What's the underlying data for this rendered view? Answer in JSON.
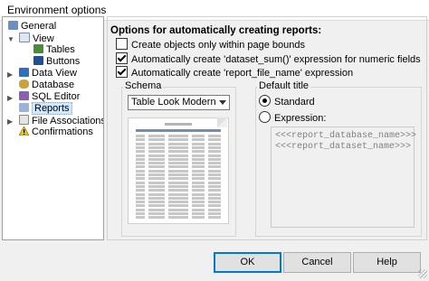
{
  "window": {
    "title": "Environment options"
  },
  "tree": {
    "items": [
      {
        "label": "General",
        "icon": "general-icon"
      },
      {
        "label": "View",
        "icon": "view-icon"
      },
      {
        "label": "Tables",
        "icon": "tables-icon"
      },
      {
        "label": "Buttons",
        "icon": "buttons-icon"
      },
      {
        "label": "Data View",
        "icon": "data-view-icon"
      },
      {
        "label": "Database",
        "icon": "database-icon"
      },
      {
        "label": "SQL Editor",
        "icon": "sql-editor-icon"
      },
      {
        "label": "Reports",
        "icon": "reports-icon"
      },
      {
        "label": "File Associations",
        "icon": "file-associations-icon"
      },
      {
        "label": "Confirmations",
        "icon": "confirmations-icon"
      }
    ],
    "selected": "Reports"
  },
  "options": {
    "heading": "Options for automatically creating reports:",
    "checkboxes": [
      {
        "label": "Create objects only within page bounds",
        "checked": false
      },
      {
        "label": "Automatically create 'dataset_sum()' expression for numeric fields",
        "checked": true
      },
      {
        "label": "Automatically create 'report_file_name' expression",
        "checked": true
      }
    ]
  },
  "schema": {
    "label": "Schema",
    "selected": "Table Look Modern"
  },
  "default_title": {
    "label": "Default title",
    "standard": "Standard",
    "expression": "Expression:",
    "selected": "Standard",
    "expression_lines": [
      "<<<report_database_name>>>",
      "<<<report_dataset_name>>>"
    ]
  },
  "buttons": {
    "ok": "OK",
    "cancel": "Cancel",
    "help": "Help"
  },
  "colors": {
    "accent": "#0078d7",
    "selection": "#cde8ff"
  }
}
